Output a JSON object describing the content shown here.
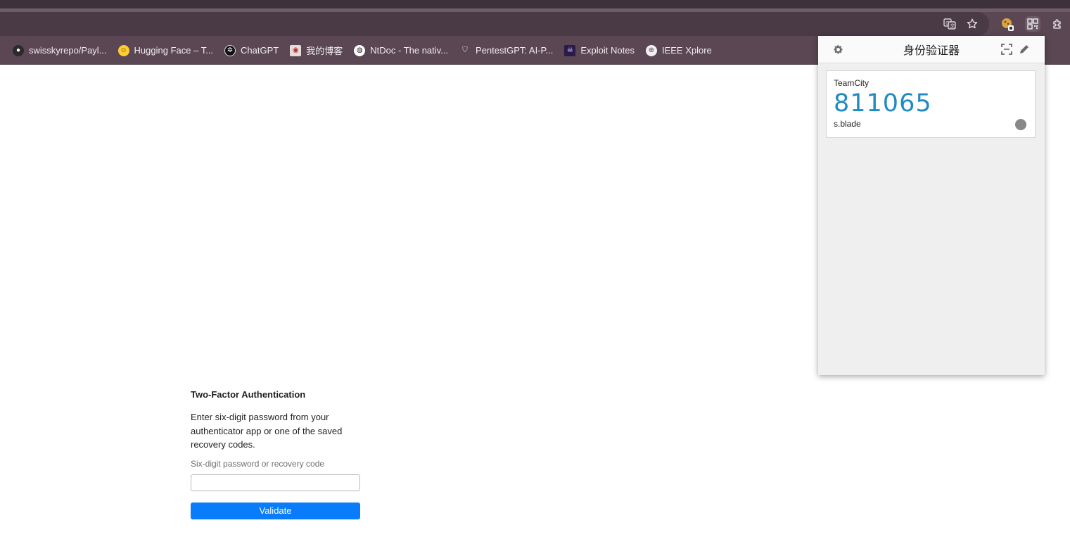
{
  "browser": {
    "bookmarks": [
      {
        "label": "swisskyrepo/Payl...",
        "icon": "github-icon"
      },
      {
        "label": "Hugging Face – T...",
        "icon": "hugging-face-icon"
      },
      {
        "label": "ChatGPT",
        "icon": "chatgpt-icon"
      },
      {
        "label": "我的博客",
        "icon": "avatar-icon"
      },
      {
        "label": "NtDoc - The nativ...",
        "icon": "ntdoc-icon"
      },
      {
        "label": "PentestGPT: AI-P...",
        "icon": "shield-icon"
      },
      {
        "label": "Exploit Notes",
        "icon": "skull-icon"
      },
      {
        "label": "IEEE Xplore",
        "icon": "globe-icon"
      }
    ],
    "toolbar_icons": [
      "translate-icon",
      "star-icon",
      "cookie-extension-icon",
      "qr-authenticator-icon",
      "extensions-puzzle-icon"
    ]
  },
  "page": {
    "title": "Two-Factor Authentication",
    "description": "Enter six-digit password from your authenticator app or one of the saved recovery codes.",
    "field_label": "Six-digit password or recovery code",
    "field_value": "",
    "button_label": "Validate",
    "colors": {
      "button": "#087cfa"
    }
  },
  "authenticator": {
    "title": "身份验证器",
    "header_icons": [
      "gear-icon",
      "scan-qr-icon",
      "pencil-icon"
    ],
    "entries": [
      {
        "issuer": "TeamCity",
        "code": "811065",
        "account": "s.blade"
      }
    ],
    "colors": {
      "code": "#1e8bc3"
    }
  }
}
